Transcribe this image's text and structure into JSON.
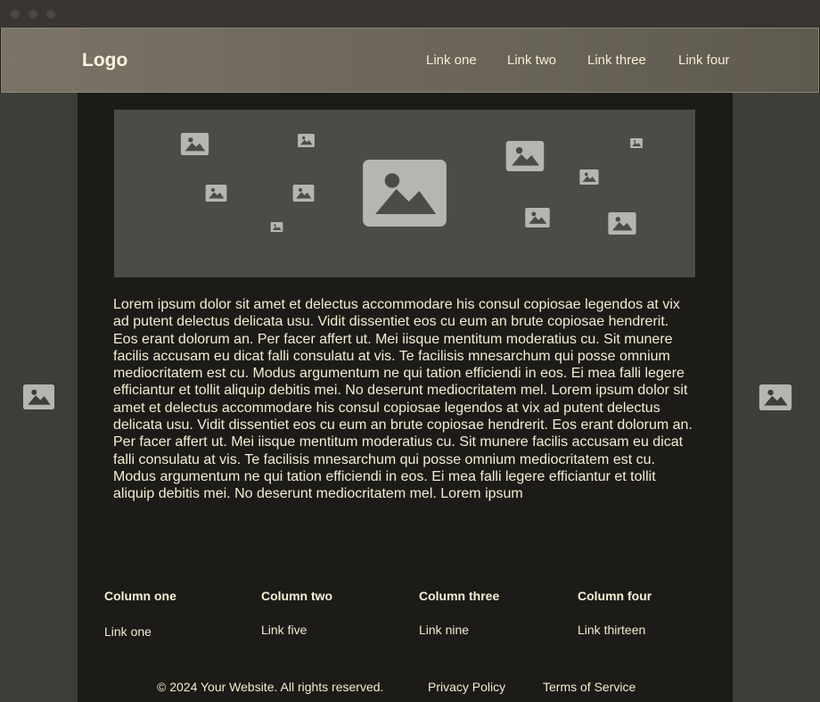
{
  "window": {
    "controls": [
      "close",
      "minimize",
      "maximize"
    ]
  },
  "header": {
    "logo": "Logo",
    "nav": [
      "Link one",
      "Link two",
      "Link three",
      "Link four"
    ]
  },
  "hero": {
    "icon": "image-placeholder-icon"
  },
  "sidebars": {
    "left_icon": "image-placeholder-icon",
    "right_icon": "image-placeholder-icon"
  },
  "content": {
    "paragraph": "Lorem ipsum dolor sit amet et delectus accommodare his consul copiosae legendos at vix ad putent delectus delicata usu. Vidit dissentiet eos cu eum an brute copiosae hendrerit. Eos erant dolorum an. Per facer affert ut. Mei iisque mentitum moderatius cu. Sit munere facilis accusam eu dicat falli consulatu at vis. Te facilisis mnesarchum qui posse omnium mediocritatem est cu. Modus argumentum ne qui tation efficiendi in eos. Ei mea falli legere efficiantur et tollit aliquip debitis mei. No deserunt mediocritatem mel. Lorem ipsum dolor sit amet et delectus accommodare his consul copiosae legendos at vix ad putent delectus delicata usu. Vidit dissentiet eos cu eum an brute copiosae hendrerit. Eos erant dolorum an. Per facer affert ut. Mei iisque mentitum moderatius cu. Sit munere facilis accusam eu dicat falli consulatu at vis. Te facilisis mnesarchum qui posse omnium mediocritatem est cu. Modus argumentum ne qui tation efficiendi in eos. Ei mea falli legere efficiantur et tollit aliquip debitis mei. No deserunt mediocritatem mel. Lorem ipsum"
  },
  "footer": {
    "columns": [
      {
        "title": "Column one",
        "link": "Link one"
      },
      {
        "title": "Column two",
        "link": "Link five"
      },
      {
        "title": "Column three",
        "link": "Link nine"
      },
      {
        "title": "Column four",
        "link": "Link thirteen"
      }
    ],
    "copyright": "© 2024 Your Website. All rights reserved.",
    "privacy": "Privacy Policy",
    "terms": "Terms of Service"
  },
  "colors": {
    "header_bg": "#7a7366",
    "page_bg": "#1c1b17",
    "sidebar_bg": "#3f3d37",
    "hero_bg": "#4d4b45",
    "placeholder": "#b7b5b0",
    "text": "#f4ecd4"
  }
}
